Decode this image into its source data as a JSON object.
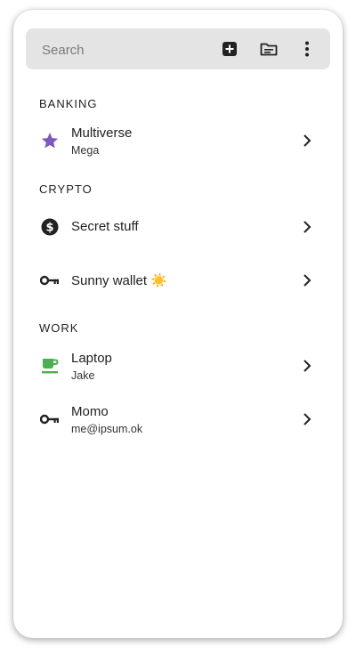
{
  "search": {
    "placeholder": "Search"
  },
  "toolbar": {
    "add_icon": "add-box-icon",
    "folder_icon": "folder-icon",
    "menu_icon": "more-vert-icon"
  },
  "sections": [
    {
      "label": "BANKING",
      "items": [
        {
          "title": "Multiverse",
          "subtitle": "Mega",
          "icon": "star-icon",
          "icon_color": "#7e57c2"
        }
      ]
    },
    {
      "label": "CRYPTO",
      "items": [
        {
          "title": "Secret stuff",
          "subtitle": "",
          "icon": "dollar-coin-icon",
          "icon_color": "#222222"
        },
        {
          "title": "Sunny wallet",
          "title_emoji": "☀️",
          "subtitle": "",
          "icon": "key-icon",
          "icon_color": "#222222"
        }
      ]
    },
    {
      "label": "WORK",
      "items": [
        {
          "title": "Laptop",
          "subtitle": "Jake",
          "icon": "coffee-icon",
          "icon_color": "#4caf50"
        },
        {
          "title": "Momo",
          "subtitle": "me@ipsum.ok",
          "icon": "key-icon",
          "icon_color": "#222222"
        }
      ]
    }
  ]
}
